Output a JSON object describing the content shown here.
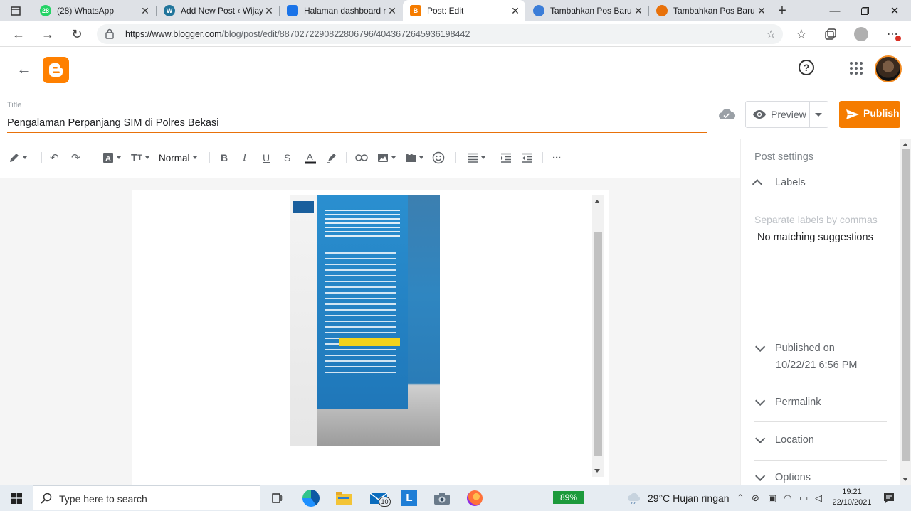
{
  "browser": {
    "tabs": [
      {
        "label": "(28) WhatsApp",
        "favicon_color": "#25d366",
        "favicon_text": "28",
        "active": false
      },
      {
        "label": "Add New Post ‹ Wijaya",
        "favicon_color": "#21759b",
        "favicon_text": "W",
        "active": false
      },
      {
        "label": "Halaman dashboard n",
        "favicon_color": "#1a73e8",
        "favicon_text": "",
        "active": false
      },
      {
        "label": "Post: Edit",
        "favicon_color": "#f57c00",
        "favicon_text": "B",
        "active": true
      },
      {
        "label": "Tambahkan Pos Baru",
        "favicon_color": "#3b7dd8",
        "favicon_text": "",
        "active": false
      },
      {
        "label": "Tambahkan Pos Baru",
        "favicon_color": "#e8710a",
        "favicon_text": "",
        "active": false
      }
    ],
    "url_host": "https://www.blogger.com",
    "url_path": "/blog/post/edit/8870272290822806796/4043672645936198442"
  },
  "editor": {
    "title_caption": "Title",
    "post_title": "Pengalaman Perpanjang SIM di Polres Bekasi",
    "preview_label": "Preview",
    "publish_label": "Publish",
    "paragraph_style": "Normal"
  },
  "settings": {
    "heading": "Post settings",
    "labels_heading": "Labels",
    "labels_placeholder": "Separate labels by commas",
    "labels_nomatch": "No matching suggestions",
    "published_heading": "Published on",
    "published_value": "10/22/21 6:56 PM",
    "permalink_heading": "Permalink",
    "location_heading": "Location",
    "options_heading": "Options"
  },
  "taskbar": {
    "search_placeholder": "Type here to search",
    "mail_badge": "10",
    "battery": "89%",
    "weather": "29°C  Hujan ringan",
    "time": "19:21",
    "date": "22/10/2021"
  }
}
